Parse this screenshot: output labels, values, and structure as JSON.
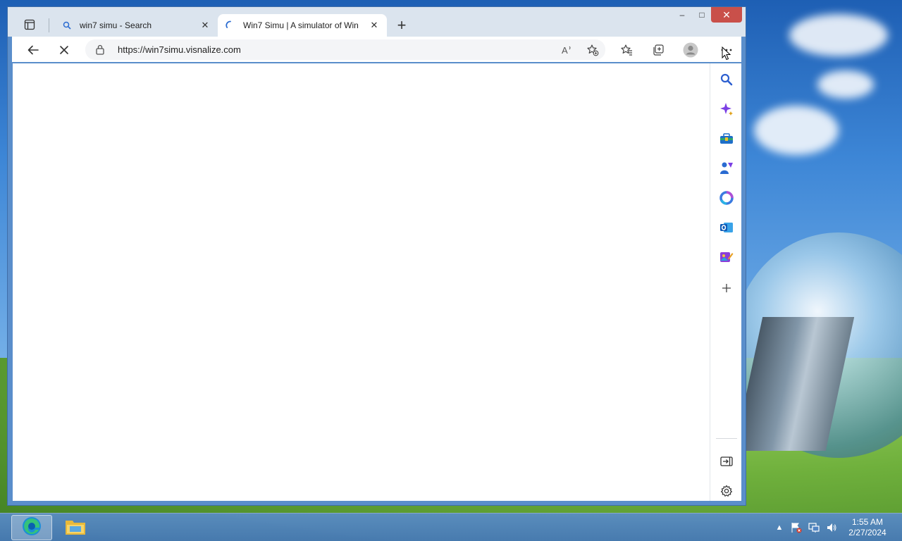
{
  "browser": {
    "tabs": [
      {
        "title": "win7 simu - Search",
        "active": false,
        "favicon": "search-icon"
      },
      {
        "title": "Win7 Simu | A simulator of Win",
        "active": true,
        "favicon": "loading-spinner-icon"
      }
    ],
    "new_tab_label": "+",
    "window_controls": {
      "minimize": "–",
      "maximize": "□",
      "close": "✕"
    },
    "address": {
      "url": "https://win7simu.visnalize.com"
    },
    "sidebar_icons": [
      "search-icon",
      "copilot-icon",
      "tools-icon",
      "games-icon",
      "office-icon",
      "outlook-icon",
      "designer-icon",
      "add-icon",
      "hide-sidebar-icon",
      "settings-icon"
    ]
  },
  "taskbar": {
    "apps": [
      "edge-icon",
      "file-explorer-icon"
    ],
    "clock": {
      "time": "1:55 AM",
      "date": "2/27/2024"
    }
  },
  "colors": {
    "accent": "#2a6bd1",
    "close_button": "#c9504a",
    "taskbar": "#4f84c4"
  }
}
